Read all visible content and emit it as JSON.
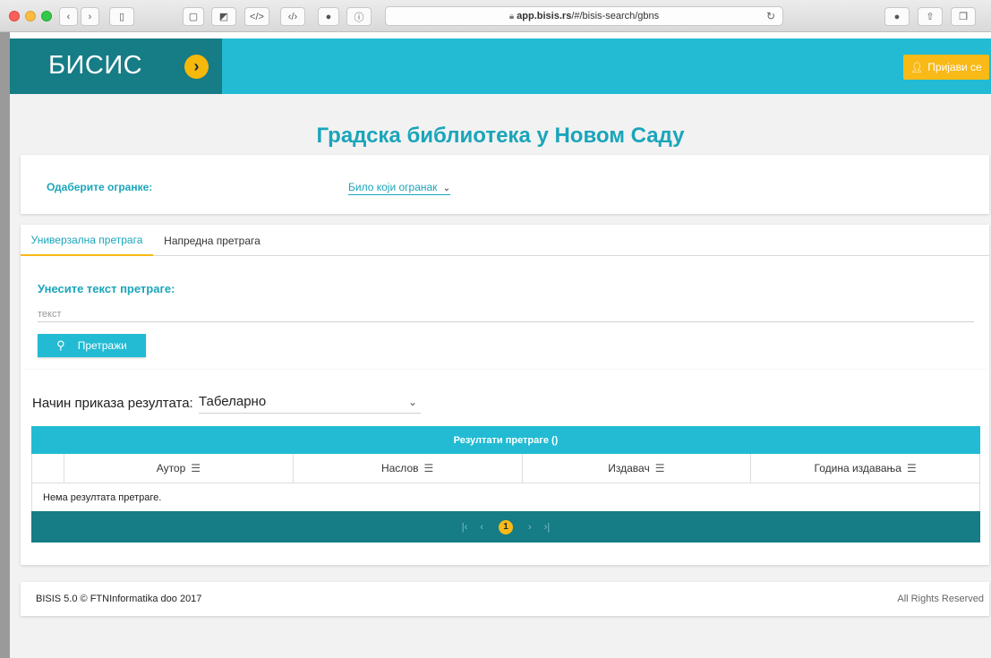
{
  "browser": {
    "address_host": "app.bisis.rs",
    "address_path": "/#/bisis-search/gbns"
  },
  "header": {
    "brand": "БИСИС",
    "login_label": "Пријави се"
  },
  "page": {
    "title": "Градска библиотека у Новом Саду"
  },
  "branch": {
    "label": "Одаберите огранке:",
    "selected": "Било који огранак"
  },
  "search": {
    "tabs": [
      "Универзална претрага",
      "Напредна претрага"
    ],
    "heading": "Унесите текст претраге:",
    "placeholder": "текст",
    "button_label": "Претражи"
  },
  "results": {
    "mode_label": "Начин приказа резултата:",
    "mode_value": "Табеларно",
    "table_title": "Резултати претраге ()",
    "columns": [
      "Аутор",
      "Наслов",
      "Издавач",
      "Година издавања"
    ],
    "empty_message": "Нема резултата претраге.",
    "current_page": "1"
  },
  "footer": {
    "left": "BISIS 5.0 © FTNInformatika doo 2017",
    "right": "All Rights Reserved"
  },
  "colors": {
    "accent": "#22bbd3",
    "dark_teal": "#167c86",
    "yellow": "#f9b916",
    "title_text": "#1aa5ba"
  }
}
